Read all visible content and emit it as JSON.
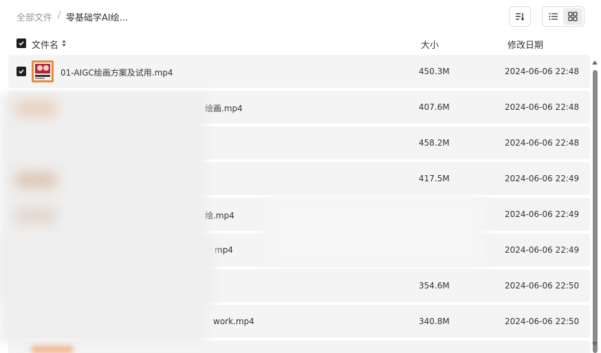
{
  "breadcrumb": {
    "root": "全部文件",
    "separator": "/",
    "current": "零基础学AI绘..."
  },
  "header": {
    "name": "文件名",
    "size": "大小",
    "date": "修改日期"
  },
  "rows": [
    {
      "name": "01-AIGC绘画方案及试用.mp4",
      "size": "450.3M",
      "date": "2024-06-06 22:48"
    },
    {
      "name": "绘画.mp4",
      "size": "407.6M",
      "date": "2024-06-06 22:48"
    },
    {
      "name": "",
      "size": "458.2M",
      "date": "2024-06-06 22:48"
    },
    {
      "name": "",
      "size": "417.5M",
      "date": "2024-06-06 22:49"
    },
    {
      "name": "绘.mp4",
      "size": "",
      "date": "2024-06-06 22:49"
    },
    {
      "name": "mp4",
      "size": "",
      "date": "2024-06-06 22:49"
    },
    {
      "name": "",
      "size": "354.6M",
      "date": "2024-06-06 22:50"
    },
    {
      "name": "work.mp4",
      "size": "340.8M",
      "date": "2024-06-06 22:50"
    }
  ],
  "icons": {
    "sort": "sort-icon",
    "list_view": "list-view-icon",
    "grid_view": "grid-view-icon"
  }
}
